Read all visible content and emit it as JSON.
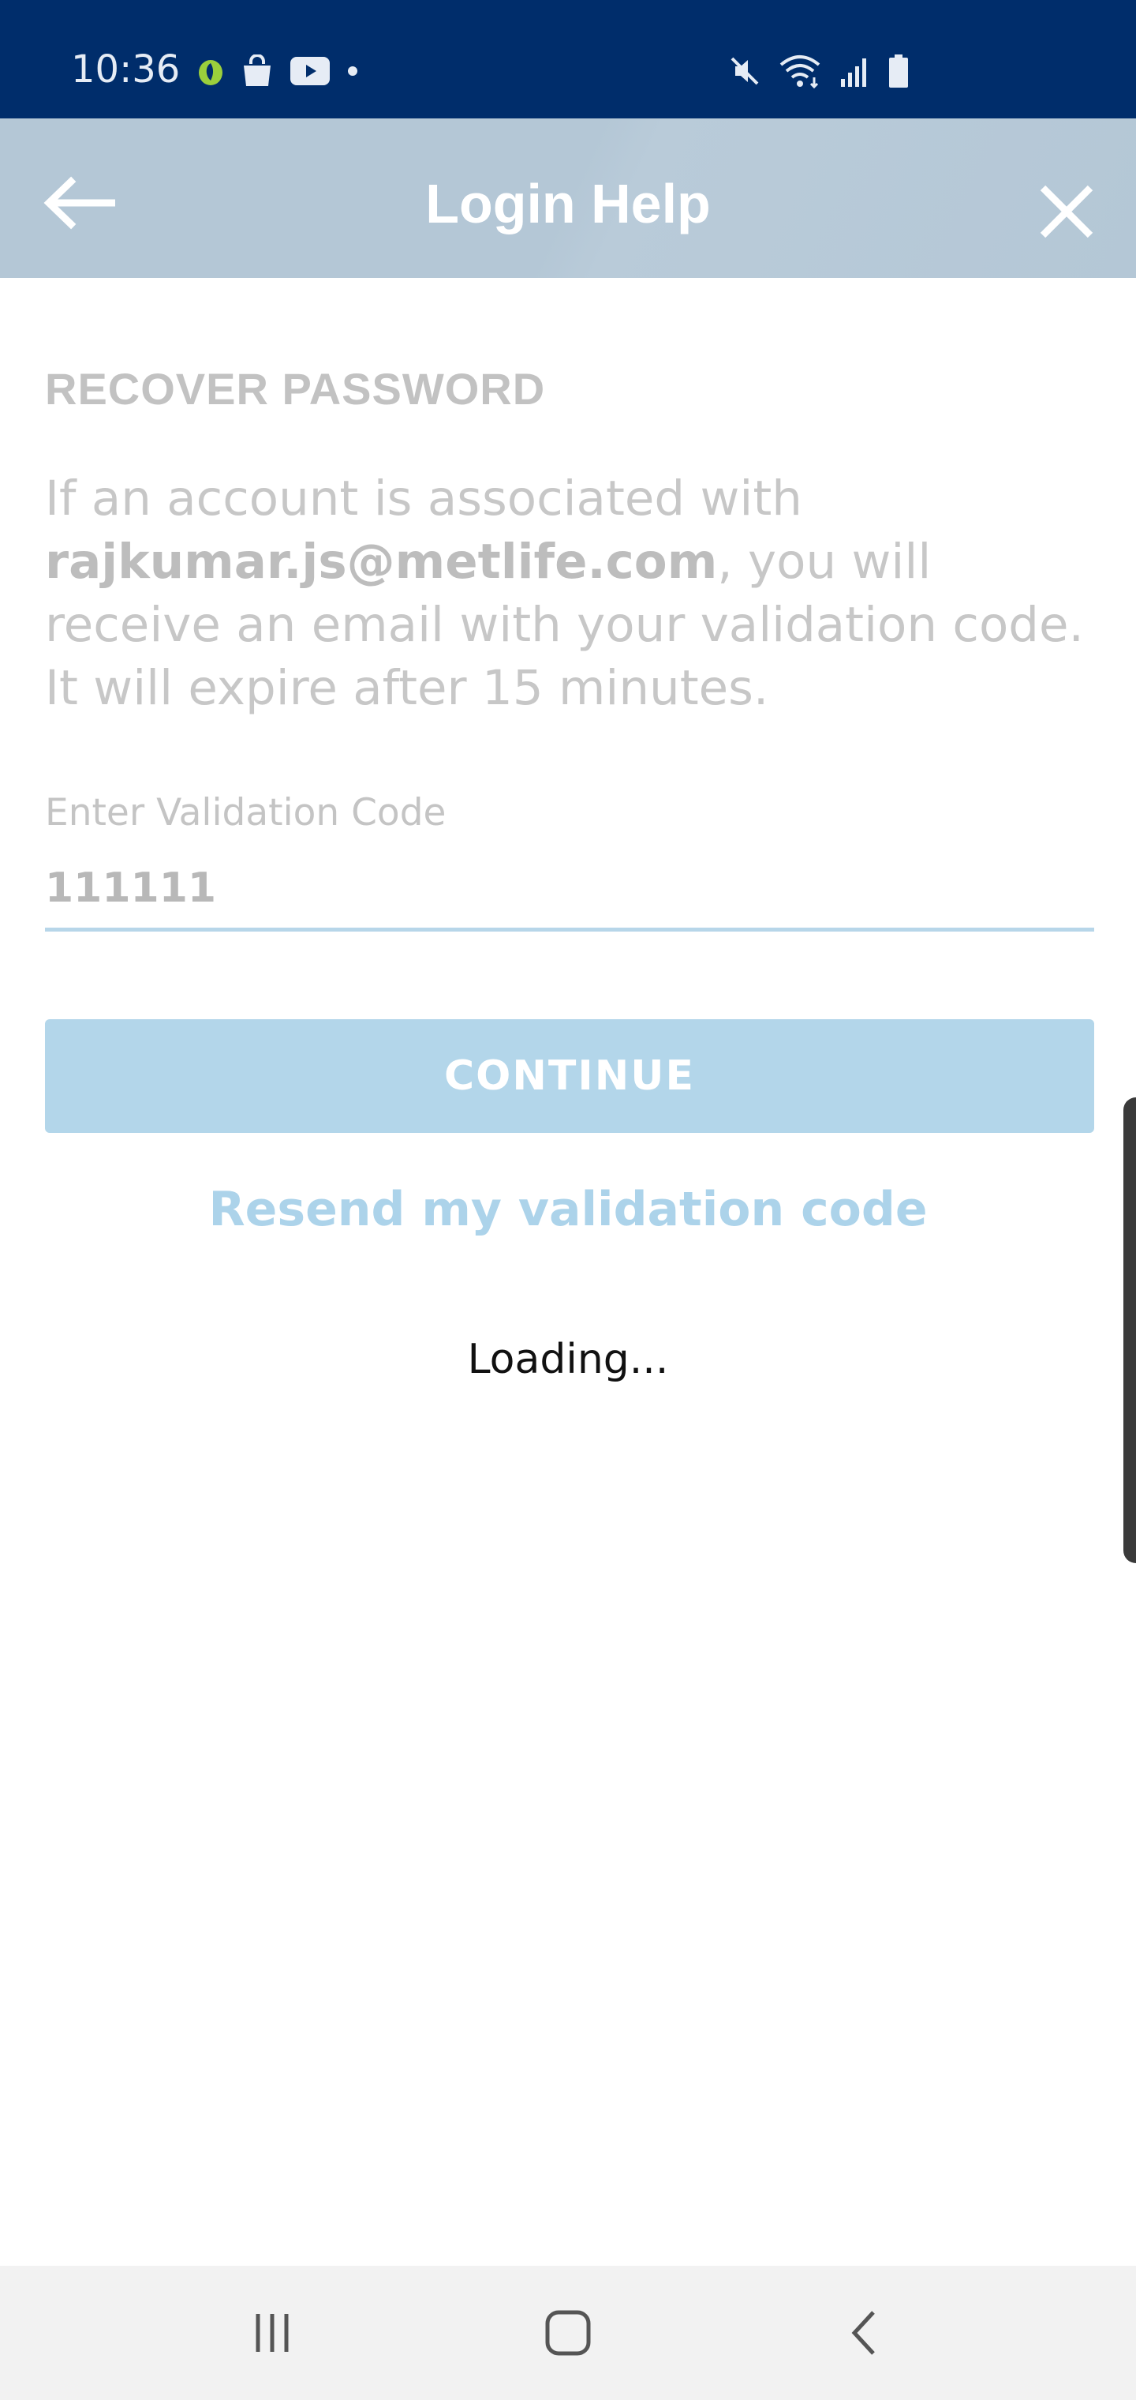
{
  "status_bar": {
    "time": "10:36",
    "left_icons": [
      "app-notification-icon",
      "shopping-bag-icon",
      "youtube-icon",
      "dot-icon"
    ],
    "right_icons": [
      "mute-icon",
      "wifi-icon",
      "signal-icon",
      "battery-icon"
    ]
  },
  "header": {
    "title": "Login Help",
    "back_icon": "arrow-left-icon",
    "close_icon": "close-icon",
    "background_color": "#b4c7d6"
  },
  "content": {
    "section_title": "RECOVER PASSWORD",
    "info_prefix": "If an account is associated with ",
    "info_email": "rajkumar.js@metlife.com",
    "info_suffix": ", you will receive an email with your validation code. It will expire after 15 minutes.",
    "field_label": "Enter Validation Code",
    "field_value": "111111",
    "continue_label": "CONTINUE",
    "resend_label": "Resend my validation code",
    "loading_text": "Loading..."
  },
  "colors": {
    "status_bar": "#002d6b",
    "button": "#b3d6ea",
    "link": "#acd3ea"
  },
  "nav_bar": {
    "items": [
      "recent-apps-icon",
      "home-icon",
      "back-icon"
    ]
  }
}
